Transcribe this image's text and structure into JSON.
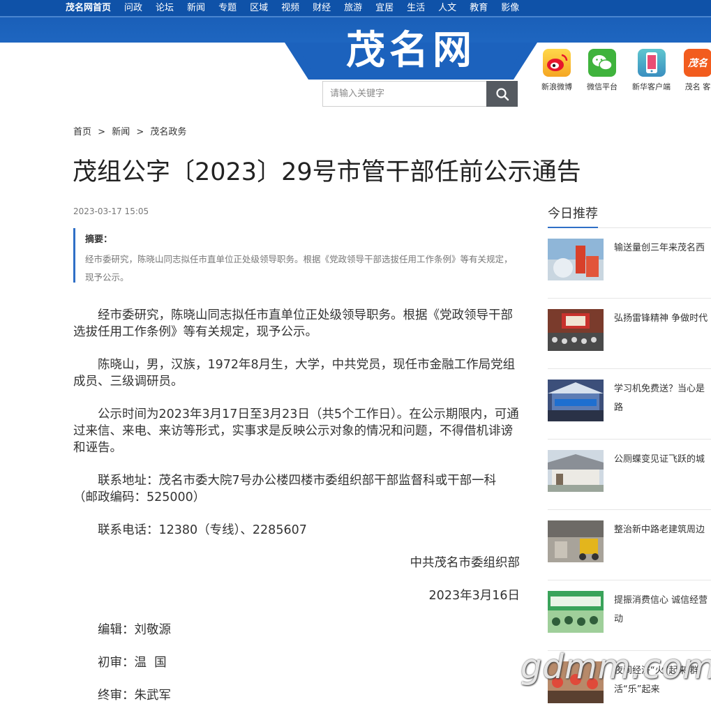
{
  "nav": [
    "茂名网首页",
    "问政",
    "论坛",
    "新闻",
    "专题",
    "区域",
    "视频",
    "财经",
    "旅游",
    "宜居",
    "生活",
    "人文",
    "教育",
    "影像"
  ],
  "logo": "茂名网",
  "search": {
    "placeholder": "请输入关键字"
  },
  "social": [
    {
      "label": "新浪微博",
      "icon": "weibo-icon"
    },
    {
      "label": "微信平台",
      "icon": "wechat-icon"
    },
    {
      "label": "新华客户端",
      "icon": "xinhua-app-icon"
    },
    {
      "label": "茂名 客",
      "icon": "maoming-app-icon"
    }
  ],
  "breadcrumb": [
    "首页",
    "新闻",
    "茂名政务"
  ],
  "breadcrumb_sep": ">",
  "article": {
    "title": "茂组公字〔2023〕29号市管干部任前公示通告",
    "date": "2023-03-17 15:05",
    "summary_label": "摘要：",
    "summary_text": "经市委研究，陈晓山同志拟任市直单位正处级领导职务。根据《党政领导干部选拔任用工作条例》等有关规定，现予公示。",
    "paragraphs": [
      "经市委研究，陈晓山同志拟任市直单位正处级领导职务。根据《党政领导干部选拔任用工作条例》等有关规定，现予公示。",
      "陈晓山，男，汉族，1972年8月生，大学，中共党员，现任市金融工作局党组成员、三级调研员。",
      "公示时间为2023年3月17日至3月23日（共5个工作日）。在公示期限内，可通过来信、来电、来访等形式，实事求是反映公示对象的情况和问题，不得借机诽谤和诬告。",
      "联系地址：茂名市委大院7号办公楼四楼市委组织部干部监督科或干部一科（邮政编码：525000）",
      "联系电话：12380（专线）、2285607"
    ],
    "signature": "中共茂名市委组织部",
    "sign_date": "2023年3月16日",
    "editor": "编辑：刘敬源",
    "reviewer": "初审：温  国",
    "final_reviewer": "终审：朱武军"
  },
  "sidebar": {
    "title": "今日推荐",
    "items": [
      {
        "text": "输送量创三年来茂名西"
      },
      {
        "text": "弘扬雷锋精神 争做时代"
      },
      {
        "text": "学习机免费送？当心是路"
      },
      {
        "text": "公厕蝶变见证飞跃的城"
      },
      {
        "text": "整治新中路老建筑周边"
      },
      {
        "text": "提振消费信心 诚信经营动"
      },
      {
        "text": "夜间经济“火”起来 群活“乐”起来"
      }
    ]
  },
  "watermark": "gdmm.com",
  "colors": {
    "brand_blue": "#0f52a8",
    "accent_blue": "#2f6fc6"
  }
}
